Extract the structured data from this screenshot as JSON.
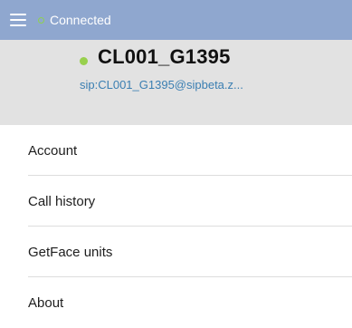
{
  "status": {
    "connection_label": "Connected",
    "connection_color": "#8fd14f",
    "bar_color": "#8fa7cf"
  },
  "account": {
    "name": "CL001_G1395",
    "sip": "sip:CL001_G1395@sipbeta.z...",
    "status_color": "#98d04d"
  },
  "menu": {
    "items": [
      {
        "label": "Account"
      },
      {
        "label": "Call history"
      },
      {
        "label": "GetFace units"
      },
      {
        "label": "About"
      }
    ]
  }
}
